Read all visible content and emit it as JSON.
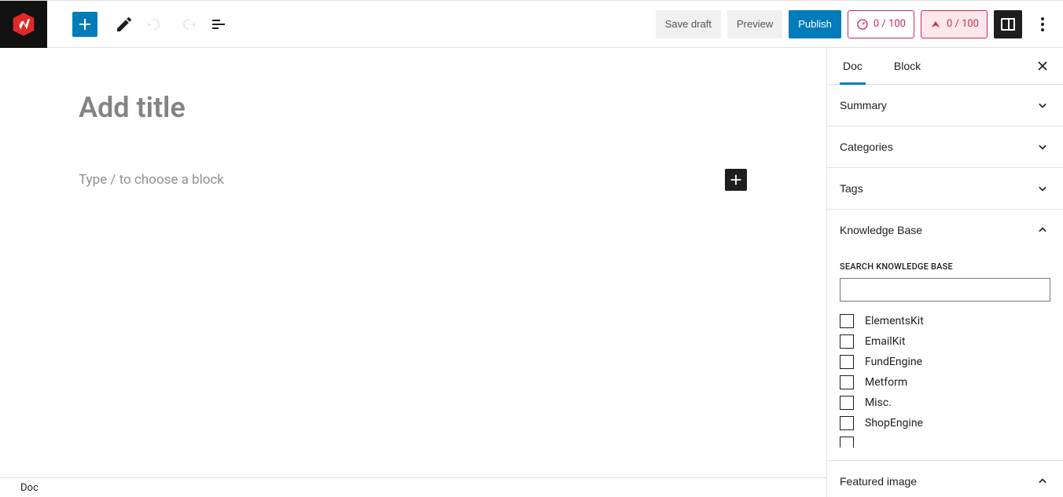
{
  "toolbar": {
    "save_draft": "Save draft",
    "preview": "Preview",
    "publish": "Publish",
    "score_a": "0 / 100",
    "score_b": "0 / 100"
  },
  "editor": {
    "title_placeholder": "Add title",
    "block_placeholder": "Type / to choose a block"
  },
  "sidebar": {
    "tab_doc": "Doc",
    "tab_block": "Block",
    "panels": {
      "summary": "Summary",
      "categories": "Categories",
      "tags": "Tags",
      "knowledge_base": "Knowledge Base",
      "featured_image": "Featured image"
    },
    "kb_search_label": "SEARCH KNOWLEDGE BASE",
    "kb_items": [
      "ElementsKit",
      "EmailKit",
      "FundEngine",
      "Metform",
      "Misc.",
      "ShopEngine"
    ]
  },
  "statusbar": {
    "breadcrumb": "Doc"
  }
}
